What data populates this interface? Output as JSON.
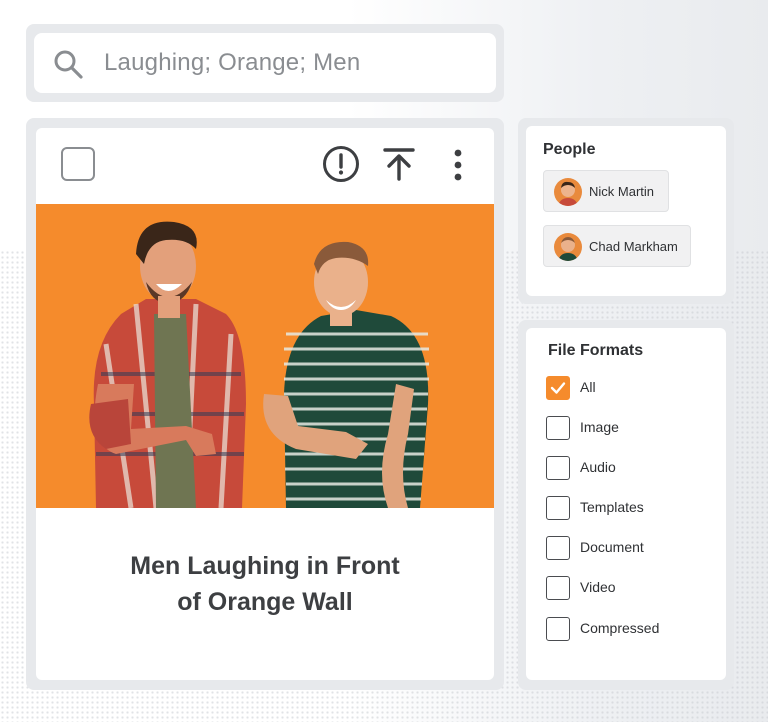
{
  "search": {
    "value": "Laughing; Orange; Men"
  },
  "card": {
    "title_line1": "Men Laughing in Front",
    "title_line2": "of Orange Wall",
    "icons": [
      "report-icon",
      "upload-icon",
      "more-vertical-icon"
    ],
    "photo_bg": "#f58b2c"
  },
  "people": {
    "title": "People",
    "items": [
      {
        "name": "Nick Martin"
      },
      {
        "name": "Chad Markham"
      }
    ]
  },
  "file_formats": {
    "title": "File Formats",
    "items": [
      {
        "label": "All",
        "checked": true
      },
      {
        "label": "Image",
        "checked": false
      },
      {
        "label": "Audio",
        "checked": false
      },
      {
        "label": "Templates",
        "checked": false
      },
      {
        "label": "Document",
        "checked": false
      },
      {
        "label": "Video",
        "checked": false
      },
      {
        "label": "Compressed",
        "checked": false
      }
    ]
  },
  "colors": {
    "accent": "#f58b2c",
    "frame": "#e7e9ec"
  }
}
